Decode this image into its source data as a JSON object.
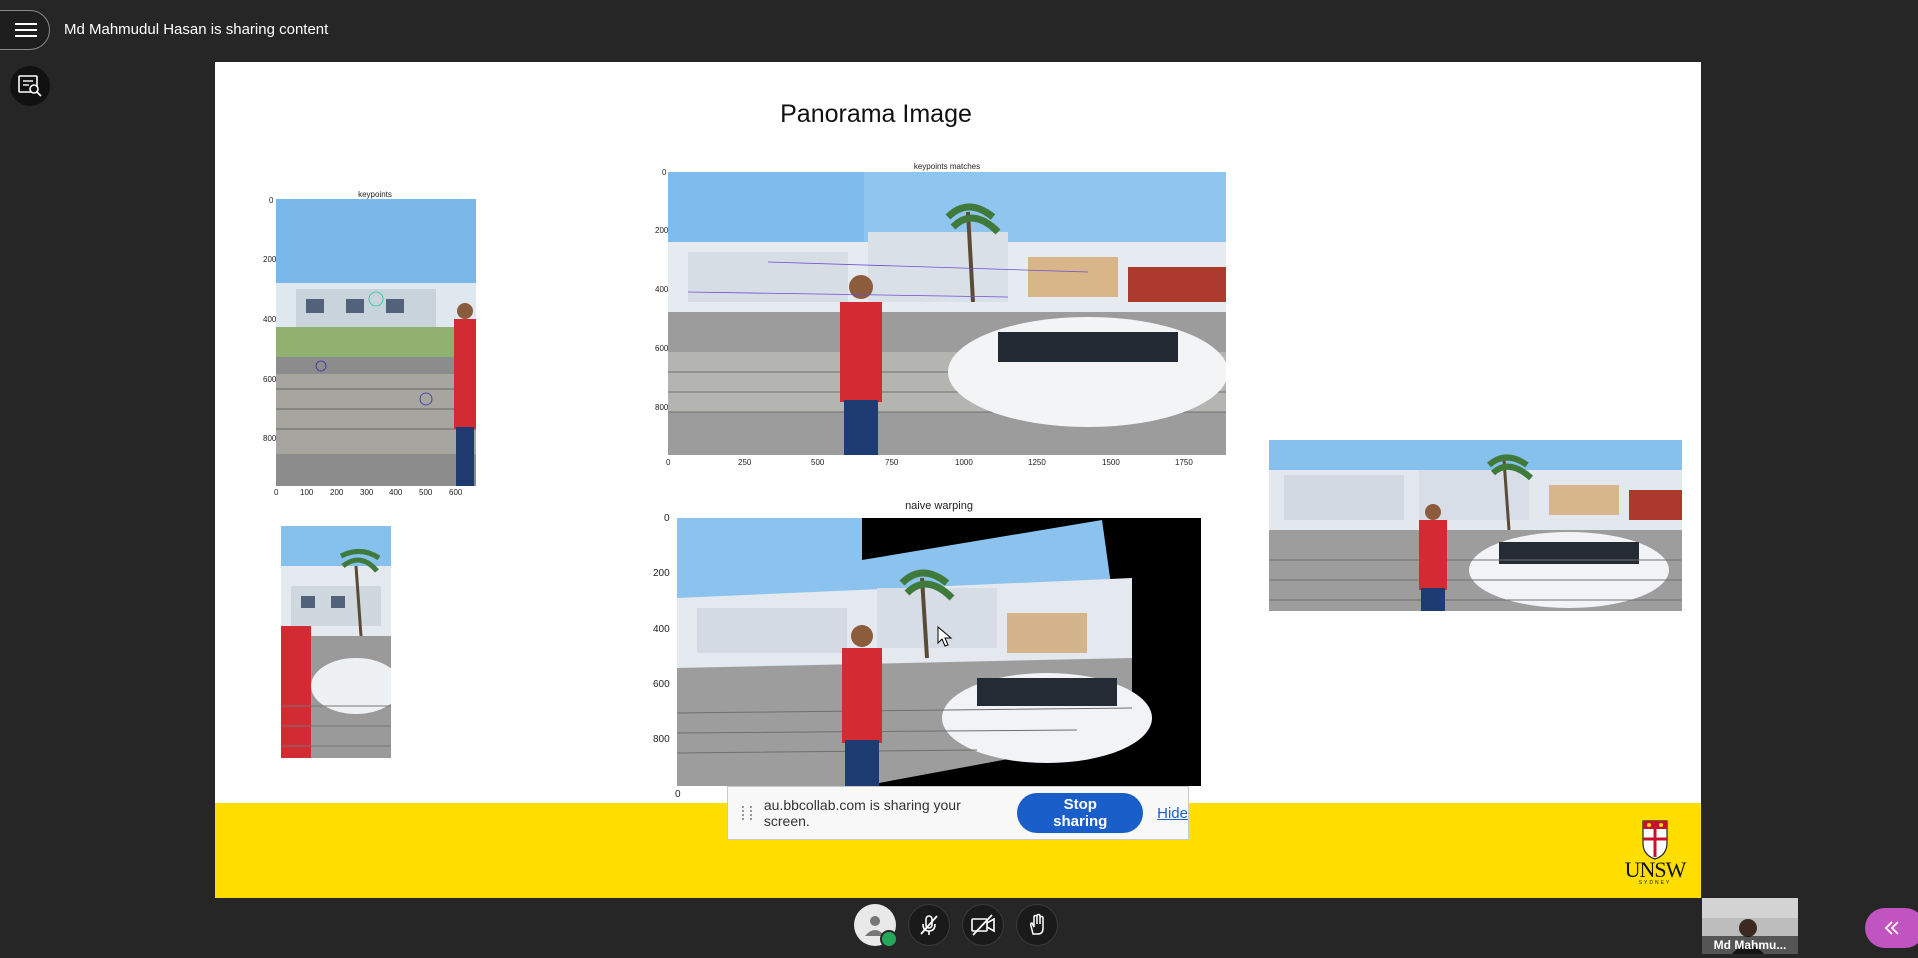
{
  "session": {
    "sharing_title": "Md Mahmudul Hasan is sharing content"
  },
  "slide": {
    "title": "Panorama Image",
    "fig_keypoints": {
      "title": "keypoints",
      "y_ticks": [
        "0",
        "200",
        "400",
        "600",
        "800"
      ],
      "x_ticks": [
        "0",
        "100",
        "200",
        "300",
        "400",
        "500",
        "600"
      ]
    },
    "fig_matches": {
      "title": "keypoints matches",
      "y_ticks": [
        "0",
        "200",
        "400",
        "600",
        "800"
      ],
      "x_ticks": [
        "0",
        "250",
        "500",
        "750",
        "1000",
        "1250",
        "1500",
        "1750"
      ]
    },
    "fig_warping": {
      "title": "naive warping",
      "y_ticks": [
        "0",
        "200",
        "400",
        "600",
        "800"
      ],
      "x_ticks": [
        "0"
      ]
    },
    "logo": {
      "text": "UNSW",
      "subtext": "SYDNEY"
    }
  },
  "share_bar": {
    "message": "au.bbcollab.com is sharing your screen.",
    "stop_label": "Stop sharing",
    "hide_label": "Hide"
  },
  "participant": {
    "name": "Md Mahmu..."
  },
  "colors": {
    "band": "#ffde00",
    "stop_button": "#1a5fc9",
    "collab_button": "#c154c1",
    "status": "#26a65b"
  }
}
